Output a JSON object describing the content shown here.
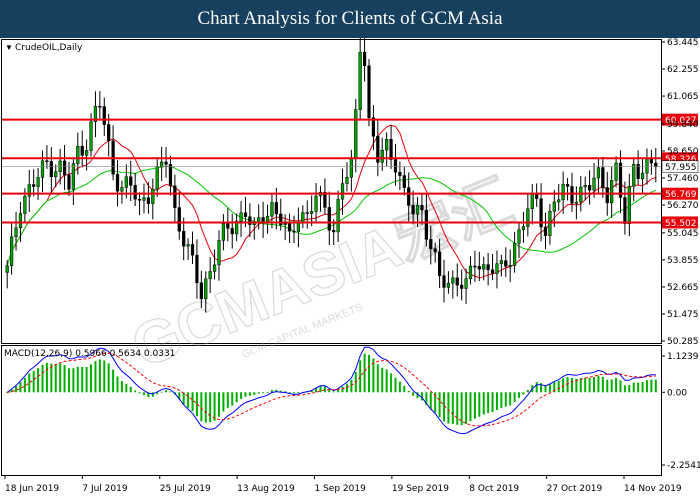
{
  "header": {
    "title": "Chart Analysis for Clients of GCM Asia"
  },
  "watermark": {
    "text": "GCMASIA宏汇",
    "subtext": "GCM CAPITAL MARKETS"
  },
  "colors": {
    "banner": "#16405d",
    "level": "#e8000b",
    "ma_fast": "#e8000b",
    "ma_slow": "#00c800",
    "bull": "#00a000",
    "bear": "#000000",
    "macd_line": "#0000ff",
    "signal_line": "#ff0000",
    "hist": "#00b000"
  },
  "chart_data": {
    "type": "candlestick",
    "symbol_label": "CrudeOIL,Daily",
    "price_axis": {
      "ticks": [
        "63.445",
        "62.255",
        "61.065",
        "59.840",
        "58.650",
        "57.460",
        "56.270",
        "55.045",
        "53.855",
        "52.665",
        "51.475",
        "50.285"
      ],
      "ylim": [
        50.285,
        63.445
      ]
    },
    "date_axis": {
      "ticks": [
        "18 Jun 2019",
        "7 Jul 2019",
        "25 Jul 2019",
        "13 Aug 2019",
        "1 Sep 2019",
        "19 Sep 2019",
        "8 Oct 2019",
        "27 Oct 2019",
        "14 Nov 2019"
      ]
    },
    "current_price": "57.955",
    "levels": [
      {
        "label": "60.027",
        "value": 60.027
      },
      {
        "label": "58.326",
        "value": 58.326
      },
      {
        "label": "56.769",
        "value": 56.769
      },
      {
        "label": "55.502",
        "value": 55.502
      }
    ],
    "anchors": [
      [
        0,
        53.4
      ],
      [
        3,
        56.4
      ],
      [
        6,
        57.2
      ],
      [
        9,
        58.1
      ],
      [
        12,
        57.9
      ],
      [
        14,
        57.1
      ],
      [
        16,
        58.6
      ],
      [
        18,
        59.1
      ],
      [
        20,
        60.3
      ],
      [
        22,
        59.8
      ],
      [
        24,
        57.8
      ],
      [
        26,
        57.0
      ],
      [
        28,
        57.1
      ],
      [
        30,
        56.3
      ],
      [
        32,
        56.8
      ],
      [
        34,
        57.5
      ],
      [
        36,
        58.3
      ],
      [
        38,
        56.0
      ],
      [
        40,
        54.8
      ],
      [
        42,
        53.6
      ],
      [
        44,
        52.4
      ],
      [
        46,
        53.4
      ],
      [
        48,
        54.6
      ],
      [
        50,
        55.2
      ],
      [
        52,
        55.6
      ],
      [
        54,
        56.0
      ],
      [
        56,
        55.0
      ],
      [
        58,
        55.9
      ],
      [
        60,
        56.2
      ],
      [
        62,
        55.6
      ],
      [
        64,
        54.7
      ],
      [
        66,
        56.0
      ],
      [
        68,
        55.7
      ],
      [
        70,
        56.6
      ],
      [
        72,
        56.2
      ],
      [
        74,
        55.2
      ],
      [
        76,
        57.2
      ],
      [
        78,
        58.0
      ],
      [
        80,
        62.6
      ],
      [
        82,
        59.8
      ],
      [
        84,
        58.3
      ],
      [
        86,
        58.9
      ],
      [
        88,
        58.2
      ],
      [
        90,
        56.6
      ],
      [
        92,
        56.0
      ],
      [
        94,
        56.1
      ],
      [
        96,
        54.4
      ],
      [
        98,
        53.0
      ],
      [
        100,
        52.8
      ],
      [
        102,
        53.1
      ],
      [
        104,
        52.6
      ],
      [
        106,
        53.8
      ],
      [
        108,
        53.5
      ],
      [
        110,
        53.6
      ],
      [
        112,
        53.3
      ],
      [
        114,
        54.0
      ],
      [
        116,
        55.1
      ],
      [
        118,
        56.1
      ],
      [
        120,
        56.4
      ],
      [
        122,
        55.1
      ],
      [
        124,
        56.5
      ],
      [
        126,
        56.8
      ],
      [
        128,
        56.7
      ],
      [
        130,
        56.9
      ],
      [
        132,
        57.1
      ],
      [
        134,
        57.5
      ],
      [
        136,
        56.9
      ],
      [
        138,
        57.8
      ],
      [
        140,
        55.5
      ],
      [
        142,
        58.0
      ],
      [
        144,
        57.9
      ],
      [
        146,
        57.95
      ]
    ],
    "macd": {
      "label": "MACD(12,26,9) 0.5966 0.5634 0.0331",
      "ticks": [
        "1.1239",
        "0.00",
        "-2.2541"
      ],
      "ylim": [
        -2.2541,
        1.1239
      ]
    }
  }
}
